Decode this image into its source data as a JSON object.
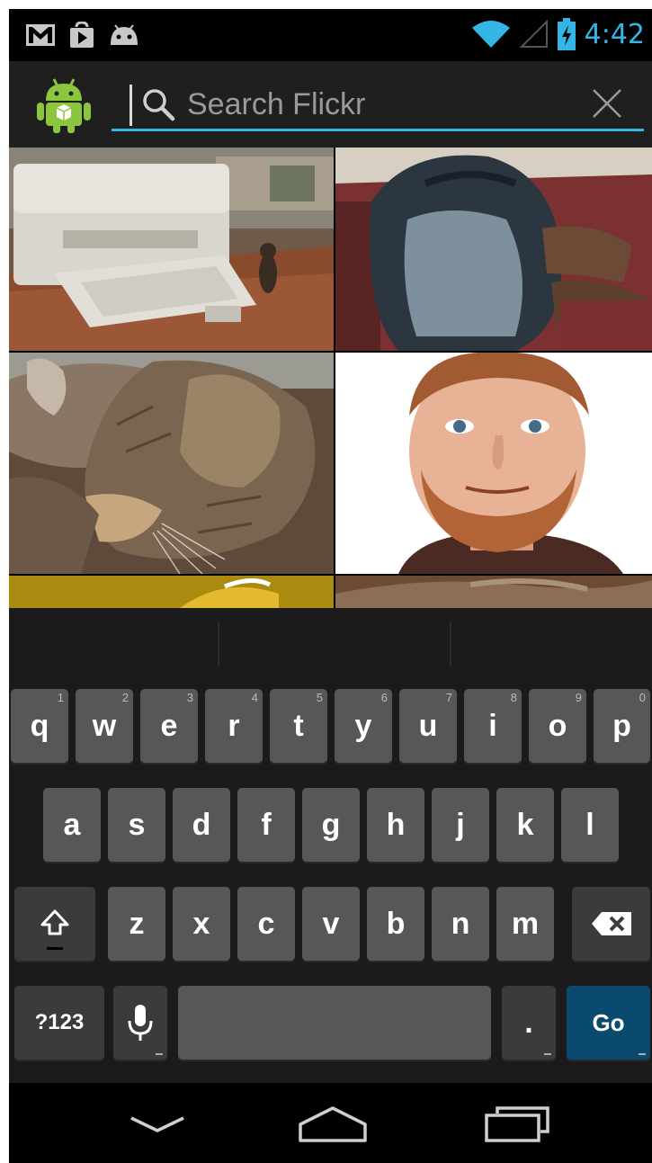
{
  "status_bar": {
    "time": "4:42",
    "icons": [
      "gmail-icon",
      "play-store-icon",
      "android-debug-icon",
      "wifi-icon",
      "signal-icon",
      "battery-charging-icon"
    ]
  },
  "action_bar": {
    "app_icon": "android-app-icon",
    "search": {
      "value": "",
      "placeholder": "Search Flickr"
    },
    "clear_icon": "close-icon"
  },
  "photos": [
    {
      "subject": "printer"
    },
    {
      "subject": "backpack"
    },
    {
      "subject": "cat"
    },
    {
      "subject": "man-portrait"
    },
    {
      "subject": "yellow-partial"
    },
    {
      "subject": "cat-partial"
    }
  ],
  "keyboard": {
    "row1": [
      {
        "label": "q",
        "hint": "1"
      },
      {
        "label": "w",
        "hint": "2"
      },
      {
        "label": "e",
        "hint": "3"
      },
      {
        "label": "r",
        "hint": "4"
      },
      {
        "label": "t",
        "hint": "5"
      },
      {
        "label": "y",
        "hint": "6"
      },
      {
        "label": "u",
        "hint": "7"
      },
      {
        "label": "i",
        "hint": "8"
      },
      {
        "label": "o",
        "hint": "9"
      },
      {
        "label": "p",
        "hint": "0"
      }
    ],
    "row2": [
      "a",
      "s",
      "d",
      "f",
      "g",
      "h",
      "j",
      "k",
      "l"
    ],
    "row3": [
      "z",
      "x",
      "c",
      "v",
      "b",
      "n",
      "m"
    ],
    "symbols_label": "?123",
    "period_label": ".",
    "go_label": "Go"
  },
  "nav_bar": {
    "icons": [
      "back-icon",
      "home-icon",
      "recent-apps-icon"
    ]
  },
  "colors": {
    "accent": "#33b5e5",
    "key": "#555759",
    "go_key": "#0b4a6f",
    "keyboard_bg": "#1b1b1b",
    "actionbar_bg": "#1f1f1f"
  }
}
